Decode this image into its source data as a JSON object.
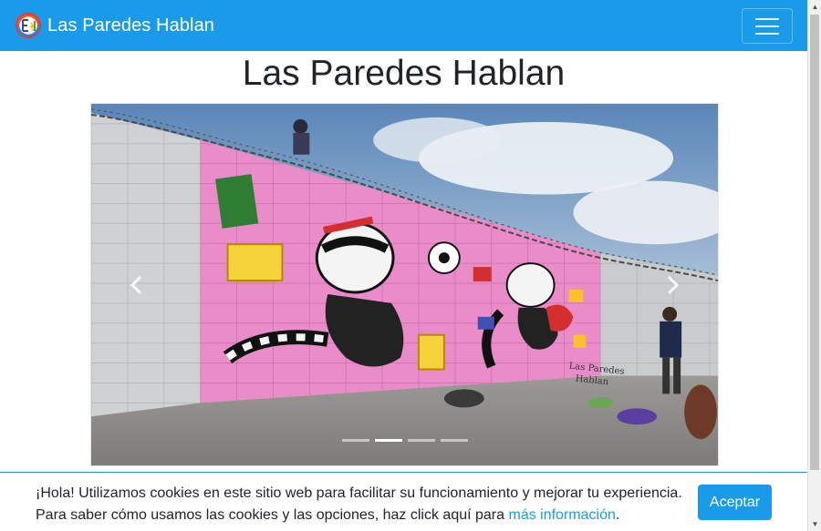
{
  "navbar": {
    "brand_text": "Las Paredes Hablan",
    "brand_color": "#1a9bea",
    "logo_icon": "lph-logo",
    "menu_icon": "hamburger-menu-icon"
  },
  "page": {
    "title": "Las Paredes Hablan"
  },
  "carousel": {
    "slide_count": 4,
    "active_index": 1,
    "prev_icon": "chevron-left-icon",
    "next_icon": "chevron-right-icon",
    "mural_signature": "Las Paredes Hablan"
  },
  "cookie_banner": {
    "text_line1": "¡Hola! Utilizamos cookies en este sitio web para facilitar su funcionamiento y mejorar tu experiencia.",
    "text_line2": "Para saber cómo usamos las cookies y las opciones, haz click aquí para",
    "link_text": "más información",
    "period": ".",
    "accept_label": "Aceptar"
  }
}
